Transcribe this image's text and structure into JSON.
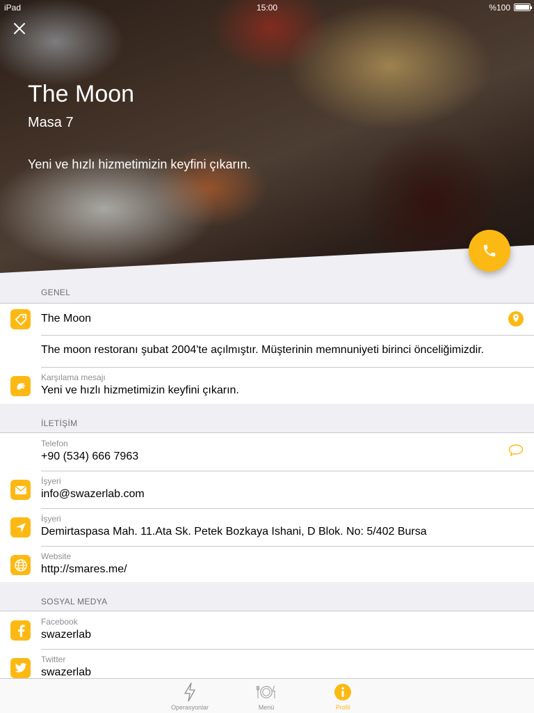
{
  "status_bar": {
    "carrier": "iPad",
    "time": "15:00",
    "battery": "%100"
  },
  "hero": {
    "title": "The Moon",
    "subtitle": "Masa 7",
    "welcome": "Yeni ve hızlı hizmetimizin keyfini çıkarın."
  },
  "sections": {
    "general": {
      "header": "GENEL",
      "name": "The Moon",
      "description": "The moon restoranı şubat 2004'te açılmıştır. Müşterinin memnuniyeti birinci önceliğimizdir.",
      "welcome_caption": "Karşılama mesajı",
      "welcome_value": "Yeni ve hızlı hizmetimizin keyfini çıkarın."
    },
    "contact": {
      "header": "İLETİŞİM",
      "phone_caption": "Telefon",
      "phone_value": "+90 (534) 666 7963",
      "email_caption": "İşyeri",
      "email_value": "info@swazerlab.com",
      "address_caption": "İşyeri",
      "address_value": "Demirtaspasa Mah. 11.Ata Sk. Petek Bozkaya Ishani, D Blok. No: 5/402 Bursa",
      "website_caption": "Website",
      "website_value": "http://smares.me/"
    },
    "social": {
      "header": "SOSYAL MEDYA",
      "facebook_caption": "Facebook",
      "facebook_value": "swazerlab",
      "twitter_caption": "Twitter",
      "twitter_value": "swazerlab"
    }
  },
  "tabs": [
    {
      "label": "Operasyonlar",
      "icon": "lightning-icon"
    },
    {
      "label": "Menü",
      "icon": "plate-cutlery-icon"
    },
    {
      "label": "Profil",
      "icon": "info-icon",
      "active": true
    }
  ],
  "colors": {
    "accent": "#fdb913",
    "background": "#efeff4"
  }
}
